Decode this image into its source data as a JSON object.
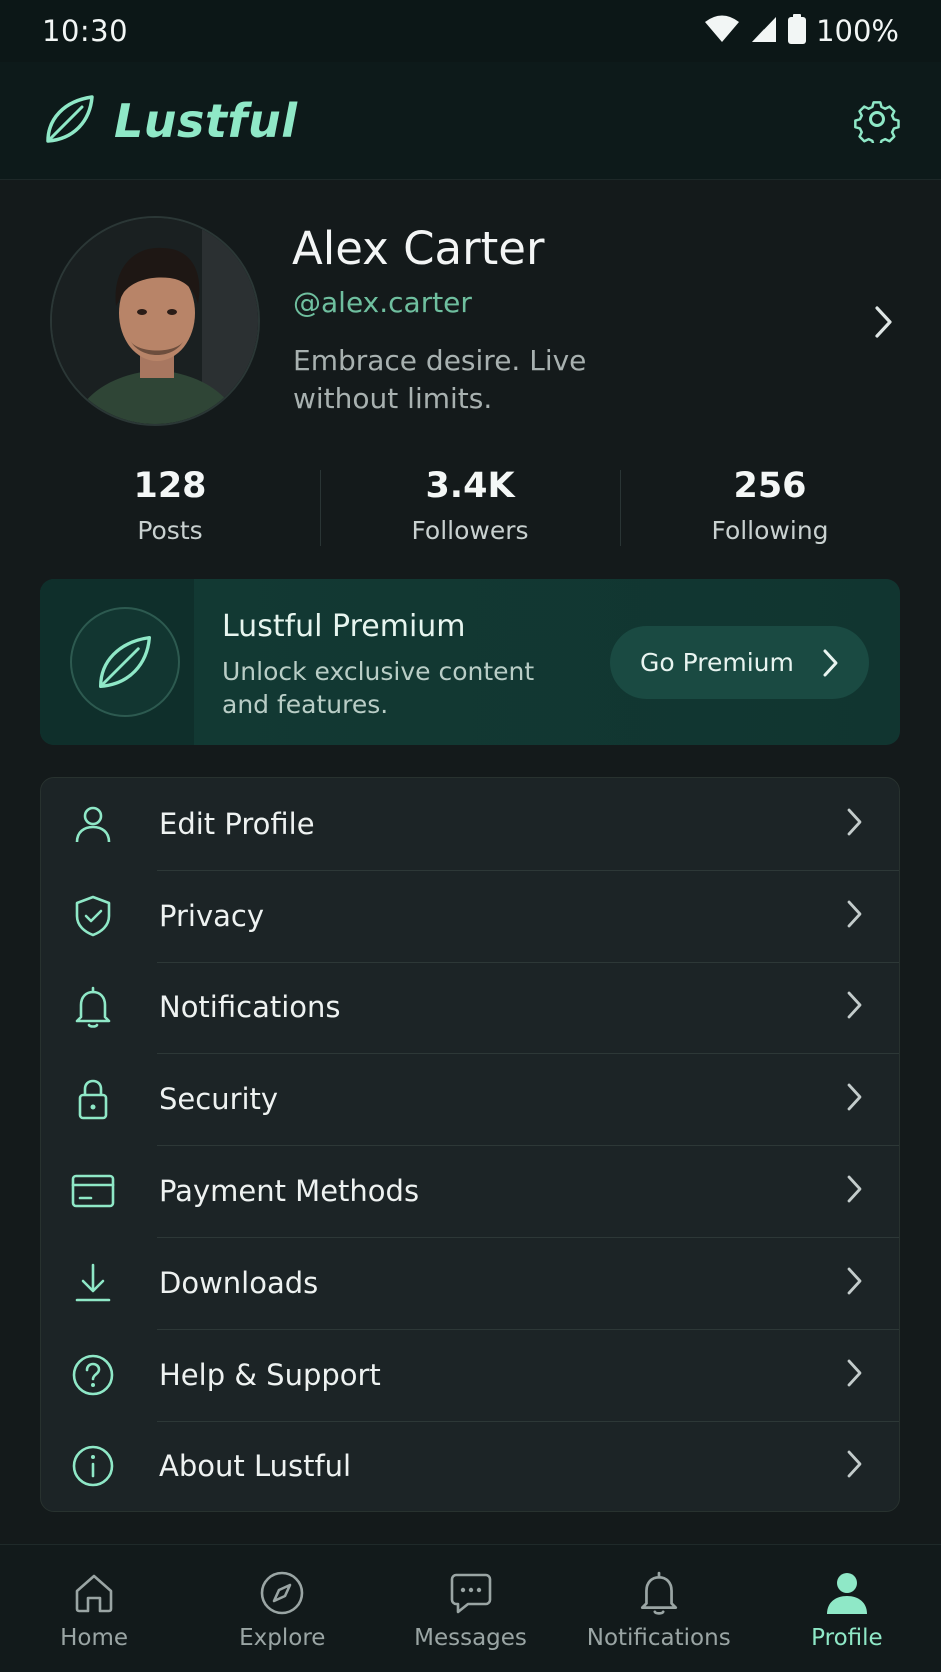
{
  "status_bar": {
    "time": "10:30",
    "battery": "100%"
  },
  "app_bar": {
    "brand": "Lustful"
  },
  "profile": {
    "name": "Alex Carter",
    "handle": "@alex.carter",
    "bio": "Embrace desire. Live without limits."
  },
  "stats": [
    {
      "value": "128",
      "label": "Posts"
    },
    {
      "value": "3.4K",
      "label": "Followers"
    },
    {
      "value": "256",
      "label": "Following"
    }
  ],
  "premium": {
    "title": "Lustful Premium",
    "subtitle": "Unlock exclusive content and features.",
    "button": "Go Premium"
  },
  "menu": [
    {
      "label": "Edit Profile",
      "icon": "user-icon"
    },
    {
      "label": "Privacy",
      "icon": "shield-check-icon"
    },
    {
      "label": "Notifications",
      "icon": "bell-icon"
    },
    {
      "label": "Security",
      "icon": "lock-icon"
    },
    {
      "label": "Payment Methods",
      "icon": "credit-card-icon"
    },
    {
      "label": "Downloads",
      "icon": "download-icon"
    },
    {
      "label": "Help & Support",
      "icon": "help-circle-icon"
    },
    {
      "label": "About Lustful",
      "icon": "info-icon"
    }
  ],
  "tabs": [
    {
      "label": "Home",
      "icon": "home-icon"
    },
    {
      "label": "Explore",
      "icon": "compass-icon"
    },
    {
      "label": "Messages",
      "icon": "message-icon"
    },
    {
      "label": "Notifications",
      "icon": "bell-icon"
    },
    {
      "label": "Profile",
      "icon": "person-icon",
      "active": true
    }
  ],
  "colors": {
    "accent": "#8fe8c7",
    "background": "#141a1b",
    "premium_bg": "#123a34"
  }
}
